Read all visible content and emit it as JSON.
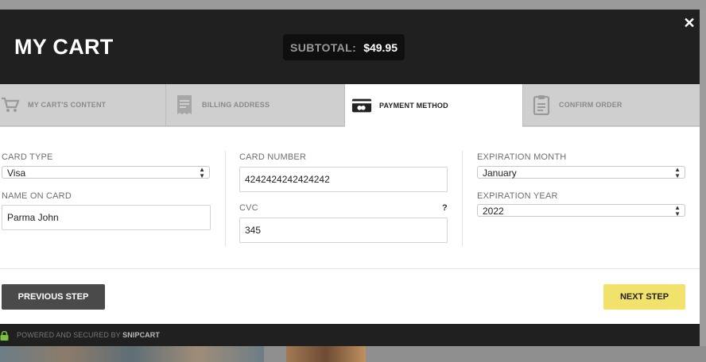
{
  "header": {
    "title": "MY CART",
    "subtotal_label": "SUBTOTAL:",
    "subtotal_value": "$49.95",
    "close_icon": "close-icon"
  },
  "tabs": [
    {
      "label": "MY CART'S CONTENT",
      "icon": "cart-icon",
      "active": false
    },
    {
      "label": "BILLING ADDRESS",
      "icon": "receipt-icon",
      "active": false
    },
    {
      "label": "PAYMENT METHOD",
      "icon": "credit-card-icon",
      "active": true
    },
    {
      "label": "CONFIRM ORDER",
      "icon": "clipboard-icon",
      "active": false
    }
  ],
  "form": {
    "card_type": {
      "label": "CARD TYPE",
      "value": "Visa"
    },
    "name_on_card": {
      "label": "NAME ON CARD",
      "value": "Parma John"
    },
    "card_number": {
      "label": "CARD NUMBER",
      "value": "4242424242424242"
    },
    "cvc": {
      "label": "CVC",
      "value": "345",
      "help": "?"
    },
    "expiration_month": {
      "label": "EXPIRATION MONTH",
      "value": "January"
    },
    "expiration_year": {
      "label": "EXPIRATION YEAR",
      "value": "2022"
    }
  },
  "actions": {
    "previous_label": "PREVIOUS STEP",
    "next_label": "NEXT STEP"
  },
  "footer": {
    "powered_prefix": "POWERED AND SECURED BY",
    "powered_brand": "SNIPCART"
  },
  "colors": {
    "header_bg": "#202020",
    "accent_next": "#f0e26a",
    "lock_green": "#7cc242"
  }
}
